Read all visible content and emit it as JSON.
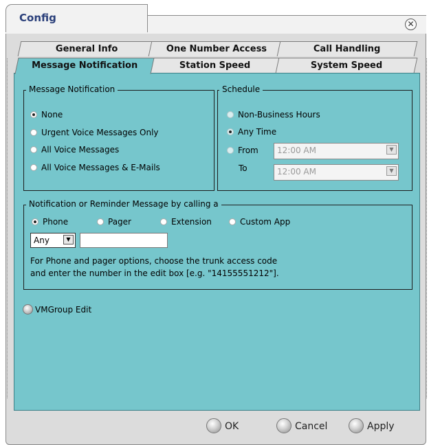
{
  "window": {
    "title": "Config"
  },
  "tabs": {
    "row1": [
      "General Info",
      "One Number Access",
      "Call Handling"
    ],
    "row2": [
      "Message Notification",
      "Station Speed",
      "System Speed"
    ],
    "active": "Message Notification"
  },
  "notification": {
    "legend": "Message Notification",
    "options": [
      "None",
      "Urgent Voice Messages Only",
      "All Voice Messages",
      "All Voice Messages & E-Mails"
    ],
    "selected": "None"
  },
  "schedule": {
    "legend": "Schedule",
    "options": [
      "Non-Business Hours",
      "Any Time",
      "From"
    ],
    "selected": "Any Time",
    "to_label": "To",
    "from_value": "12:00 AM",
    "to_value": "12:00 AM"
  },
  "reminder": {
    "legend": "Notification or Reminder Message  by calling a",
    "options": [
      "Phone",
      "Pager",
      "Extension",
      "Custom App"
    ],
    "selected": "Phone",
    "trunk_value": "Any",
    "number_value": "",
    "help_line1": "For Phone and pager options, choose the trunk access code",
    "help_line2": "and enter the number in the edit box [e.g. \"14155551212\"]."
  },
  "vmgroup_edit": "VMGroup Edit",
  "buttons": {
    "ok": "OK",
    "cancel": "Cancel",
    "apply": "Apply"
  }
}
